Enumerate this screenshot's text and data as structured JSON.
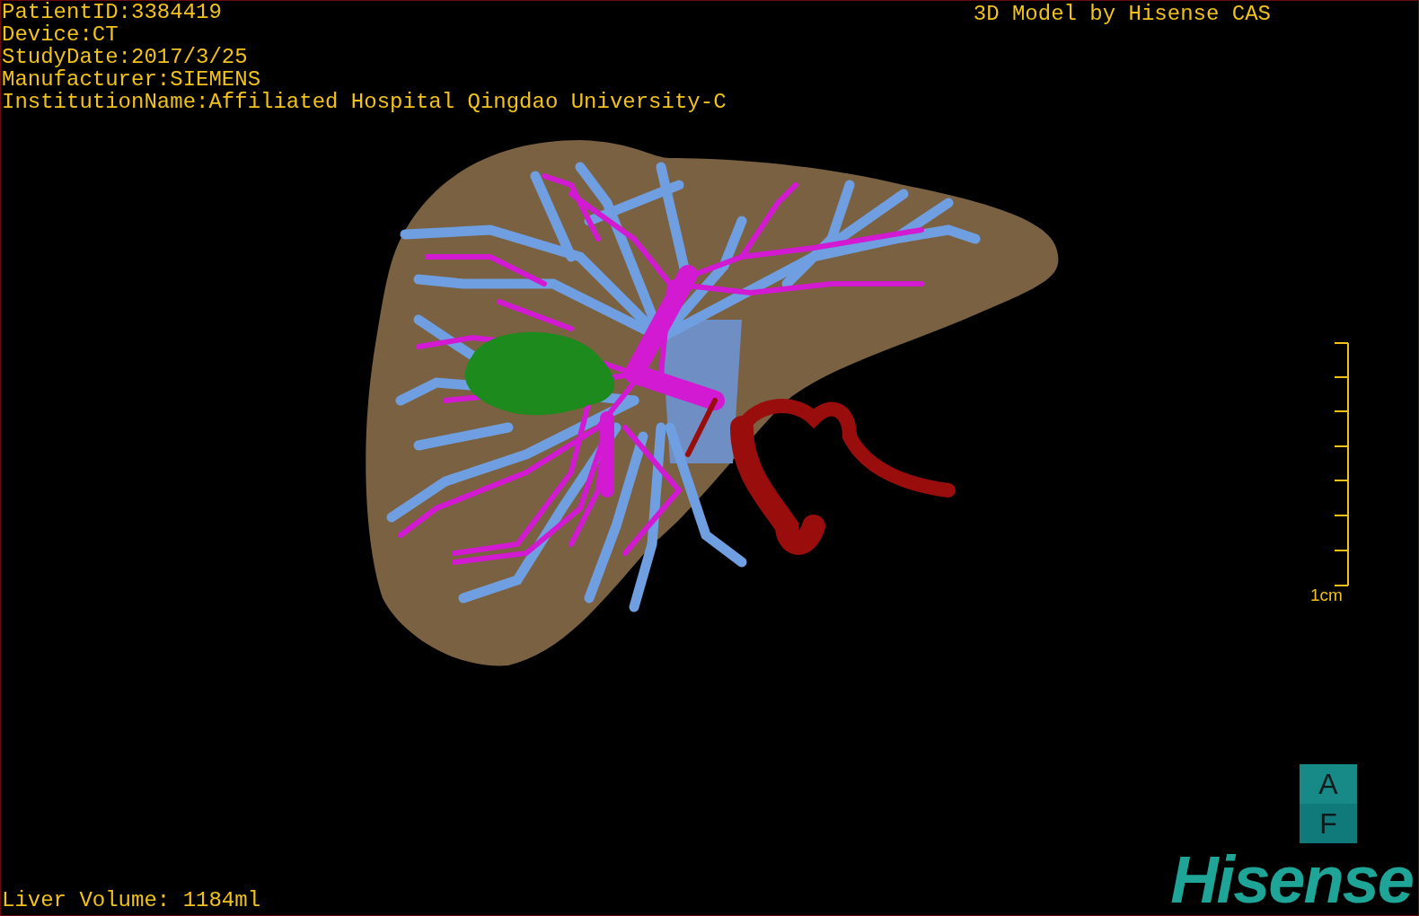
{
  "info_lines": [
    "PatientID:3384419",
    "Device:CT",
    "StudyDate:2017/3/25",
    "Manufacturer:SIEMENS",
    "InstitutionName:Affiliated Hospital Qingdao University-C"
  ],
  "title": "3D Model by Hisense CAS",
  "scale_bar": {
    "label": "1cm"
  },
  "orientation_cube": {
    "faces": [
      "A",
      "F"
    ]
  },
  "logo": "Hisense",
  "liver_volume": "Liver Volume: 1184ml"
}
